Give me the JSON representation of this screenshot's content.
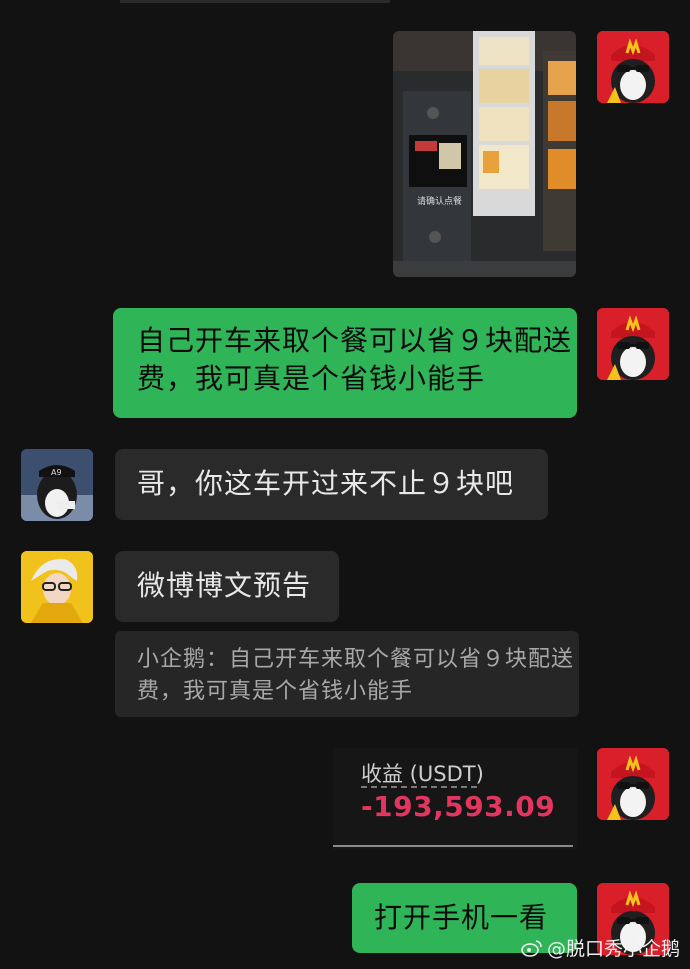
{
  "messages": {
    "m1": {
      "sender": "self",
      "type": "image"
    },
    "m2": {
      "sender": "self",
      "text": "自己开车来取个餐可以省９块配送费，我可真是个省钱小能手"
    },
    "m3": {
      "sender": "friend1",
      "text": "哥，你这车开过来不止９块吧"
    },
    "m4": {
      "sender": "friend2",
      "text": "微博博文预告"
    },
    "m4_quote": "小企鹅：自己开车来取个餐可以省９块配送费，我可真是个省钱小能手",
    "m5": {
      "sender": "self",
      "type": "card",
      "label": "收益 (USDT)",
      "value": "-193,593.09"
    },
    "m6": {
      "sender": "self",
      "text": "打开手机一看"
    }
  },
  "photo": {
    "kiosk_text": "请确认点餐"
  },
  "watermark": "@脱口秀小企鹅",
  "colors": {
    "background": "#121212",
    "bubble_self": "#2fb457",
    "bubble_other": "#2a2a2a",
    "loss": "#e2365f",
    "avatar_red": "#d81f2a"
  }
}
